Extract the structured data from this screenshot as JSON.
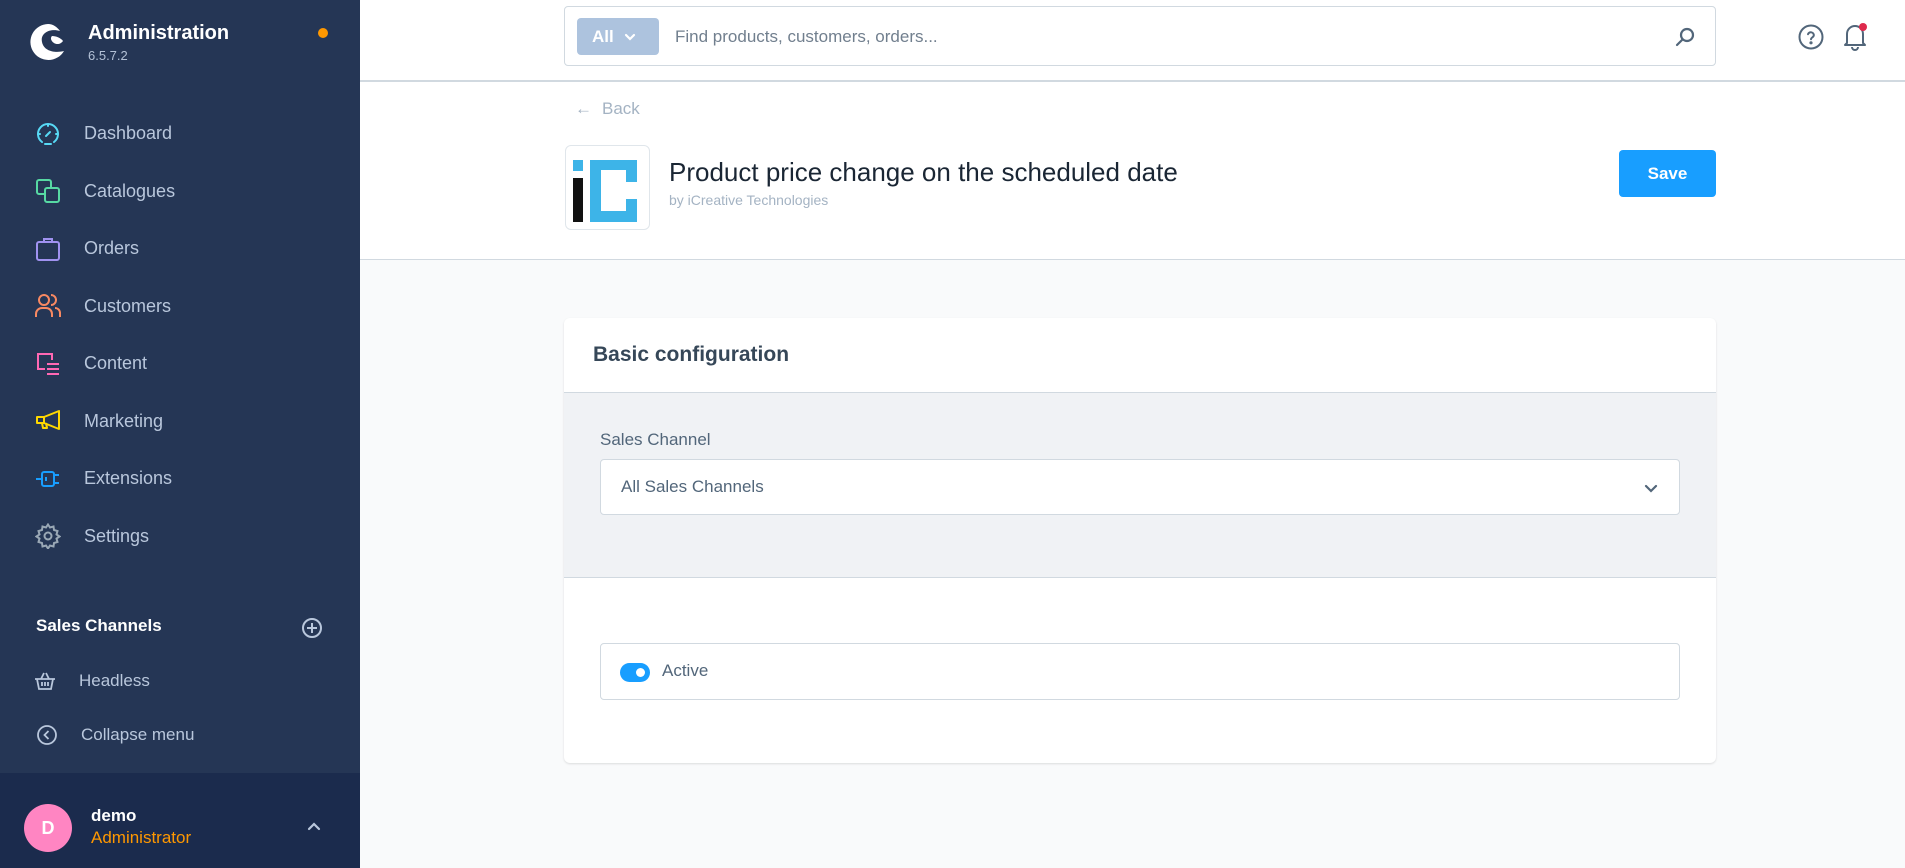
{
  "brand": {
    "title": "Administration",
    "version": "6.5.7.2",
    "notification_dot_color": "#ff9800"
  },
  "sidebar": {
    "items": [
      {
        "label": "Dashboard",
        "icon": "gauge-icon",
        "color": "#57d9f5"
      },
      {
        "label": "Catalogues",
        "icon": "catalogue-icon",
        "color": "#57d9a3"
      },
      {
        "label": "Orders",
        "icon": "shopping-bag-icon",
        "color": "#a092f0"
      },
      {
        "label": "Customers",
        "icon": "users-icon",
        "color": "#f88962"
      },
      {
        "label": "Content",
        "icon": "content-icon",
        "color": "#ff68b4"
      },
      {
        "label": "Marketing",
        "icon": "megaphone-icon",
        "color": "#ffd700"
      },
      {
        "label": "Extensions",
        "icon": "plug-icon",
        "color": "#189eff"
      },
      {
        "label": "Settings",
        "icon": "gear-icon",
        "color": "#9aa8b5"
      }
    ],
    "sales_channels": {
      "title": "Sales Channels",
      "items": [
        {
          "label": "Headless",
          "icon": "basket-icon"
        }
      ]
    },
    "collapse_label": "Collapse menu",
    "user": {
      "initial": "D",
      "name": "demo",
      "role": "Administrator"
    }
  },
  "search": {
    "type_label": "All",
    "placeholder": "Find products, customers, orders..."
  },
  "page_header": {
    "back_label": "Back",
    "title": "Product price change on the scheduled date",
    "vendor": "by iCreative Technologies",
    "save_label": "Save"
  },
  "card": {
    "title": "Basic configuration",
    "sales_channel": {
      "label": "Sales Channel",
      "value": "All Sales Channels"
    },
    "active": {
      "label": "Active",
      "checked": true
    }
  },
  "colors": {
    "sidebar_bg": "#253655",
    "user_bg": "#1b2b4d",
    "accent": "#189eff",
    "role": "#ff9800",
    "avatar": "#ff85c2"
  }
}
